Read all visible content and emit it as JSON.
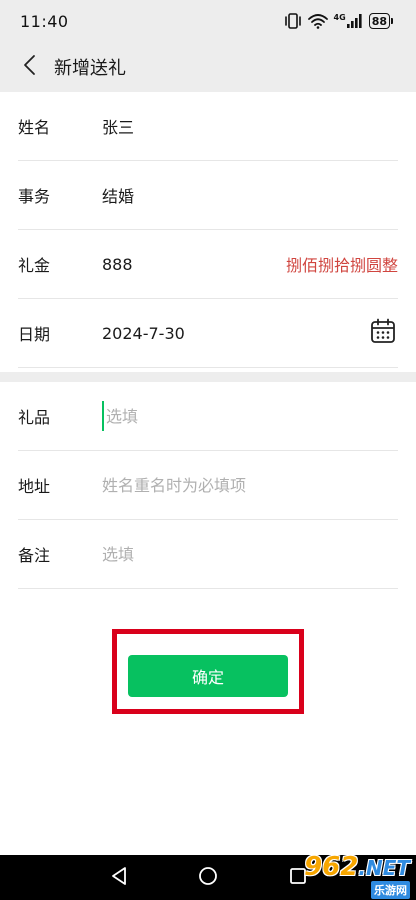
{
  "status_bar": {
    "time": "11:40",
    "battery": "88",
    "network_label": "4G"
  },
  "header": {
    "title": "新增送礼"
  },
  "form": {
    "name": {
      "label": "姓名",
      "value": "张三"
    },
    "event": {
      "label": "事务",
      "value": "结婚"
    },
    "amount": {
      "label": "礼金",
      "value": "888",
      "in_words": "捌佰捌拾捌圆整"
    },
    "date": {
      "label": "日期",
      "value": "2024-7-30"
    },
    "gift": {
      "label": "礼品",
      "placeholder": "选填"
    },
    "address": {
      "label": "地址",
      "placeholder": "姓名重名时为必填项"
    },
    "remark": {
      "label": "备注",
      "placeholder": "选填"
    }
  },
  "actions": {
    "confirm_label": "确定"
  },
  "watermark": {
    "number": "962",
    "suffix": ".NET",
    "sub": "乐游网"
  },
  "colors": {
    "accent": "#07c160",
    "amount_words": "#d0453f",
    "highlight_frame": "#d9001b",
    "background": "#ededed"
  }
}
